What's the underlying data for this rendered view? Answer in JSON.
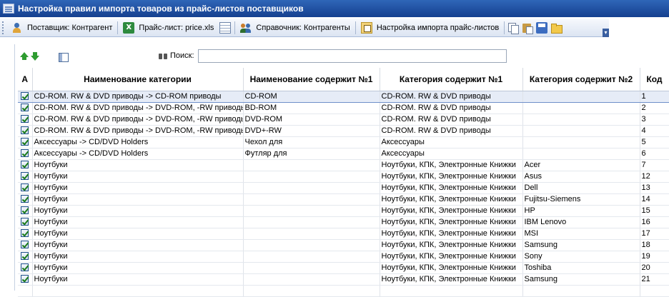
{
  "window": {
    "title": "Настройка правил импорта товаров из прайс-листов поставщиков"
  },
  "toolbar": {
    "supplier_label": "Поставщик: Контрагент",
    "pricelist_label": "Прайс-лист: price.xls",
    "directory_label": "Справочник: Контрагенты",
    "import_settings_label": "Настройка импорта прайс-листов"
  },
  "search": {
    "label": "Поиск:",
    "value": "",
    "placeholder": ""
  },
  "table": {
    "columns": [
      "А",
      "Наименование категории",
      "Наименование содержит №1",
      "Категория содержит №1",
      "Категория содержит №2",
      "Код"
    ],
    "rows": [
      {
        "checked": true,
        "category": "CD-ROM. RW & DVD приводы -> CD-ROM приводы",
        "name1": "CD-ROM",
        "cat1": "CD-ROM. RW & DVD приводы",
        "cat2": "",
        "code": "1"
      },
      {
        "checked": true,
        "category": "CD-ROM. RW & DVD приводы -> DVD-ROM, -RW  приводы",
        "name1": "BD-ROM",
        "cat1": "CD-ROM. RW & DVD приводы",
        "cat2": "",
        "code": "2"
      },
      {
        "checked": true,
        "category": "CD-ROM. RW & DVD приводы -> DVD-ROM, -RW  приводы",
        "name1": "DVD-ROM",
        "cat1": "CD-ROM. RW & DVD приводы",
        "cat2": "",
        "code": "3"
      },
      {
        "checked": true,
        "category": "CD-ROM. RW & DVD приводы -> DVD-ROM, -RW  приводы",
        "name1": "DVD+-RW",
        "cat1": "CD-ROM. RW & DVD приводы",
        "cat2": "",
        "code": "4"
      },
      {
        "checked": true,
        "category": "Аксессуары -> CD/DVD Holders",
        "name1": "Чехол для",
        "cat1": "Аксессуары",
        "cat2": "",
        "code": "5"
      },
      {
        "checked": true,
        "category": "Аксессуары -> CD/DVD Holders",
        "name1": "Футляр для",
        "cat1": "Аксессуары",
        "cat2": "",
        "code": "6"
      },
      {
        "checked": true,
        "category": "Ноутбуки",
        "name1": "",
        "cat1": "Ноутбуки, КПК, Электронные Книжки",
        "cat2": "Acer",
        "code": "7"
      },
      {
        "checked": true,
        "category": "Ноутбуки",
        "name1": "",
        "cat1": "Ноутбуки, КПК, Электронные Книжки",
        "cat2": "Asus",
        "code": "12"
      },
      {
        "checked": true,
        "category": "Ноутбуки",
        "name1": "",
        "cat1": "Ноутбуки, КПК, Электронные Книжки",
        "cat2": "Dell",
        "code": "13"
      },
      {
        "checked": true,
        "category": "Ноутбуки",
        "name1": "",
        "cat1": "Ноутбуки, КПК, Электронные Книжки",
        "cat2": "Fujitsu-Siemens",
        "code": "14"
      },
      {
        "checked": true,
        "category": "Ноутбуки",
        "name1": "",
        "cat1": "Ноутбуки, КПК, Электронные Книжки",
        "cat2": "HP",
        "code": "15"
      },
      {
        "checked": true,
        "category": "Ноутбуки",
        "name1": "",
        "cat1": "Ноутбуки, КПК, Электронные Книжки",
        "cat2": "IBM Lenovo",
        "code": "16"
      },
      {
        "checked": true,
        "category": "Ноутбуки",
        "name1": "",
        "cat1": "Ноутбуки, КПК, Электронные Книжки",
        "cat2": "MSI",
        "code": "17"
      },
      {
        "checked": true,
        "category": "Ноутбуки",
        "name1": "",
        "cat1": "Ноутбуки, КПК, Электронные Книжки",
        "cat2": "Samsung",
        "code": "18"
      },
      {
        "checked": true,
        "category": "Ноутбуки",
        "name1": "",
        "cat1": "Ноутбуки, КПК, Электронные Книжки",
        "cat2": "Sony",
        "code": "19"
      },
      {
        "checked": true,
        "category": "Ноутбуки",
        "name1": "",
        "cat1": "Ноутбуки, КПК, Электронные Книжки",
        "cat2": "Toshiba",
        "code": "20"
      },
      {
        "checked": true,
        "category": "Ноутбуки",
        "name1": "",
        "cat1": "Ноутбуки, КПК, Электронные Книжки",
        "cat2": "Samsung",
        "code": "21"
      }
    ]
  },
  "icons": {
    "title": "window-icon",
    "supplier": "supplier-person-icon",
    "pricelist": "excel-icon",
    "grid": "grid-view-icon",
    "directory": "contractors-icon",
    "import": "import-settings-icon",
    "copy": "copy-icon",
    "paste": "paste-icon",
    "save": "save-icon",
    "open": "folder-icon",
    "move_up": "arrow-up-icon",
    "move_down": "arrow-down-icon",
    "columns": "columns-icon",
    "search": "binoculars-icon"
  },
  "colors": {
    "title_bg": "#15408f",
    "accent_green": "#2e9c30",
    "selection": "#e6ecf7"
  }
}
